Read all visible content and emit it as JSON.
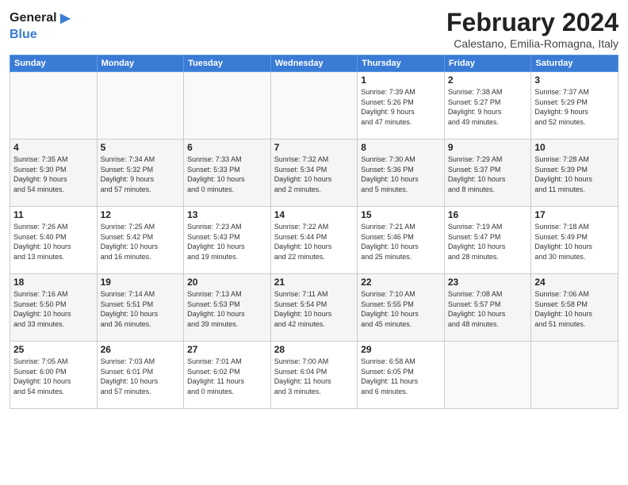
{
  "header": {
    "logo_line1": "General",
    "logo_line2": "Blue",
    "title": "February 2024",
    "subtitle": "Calestano, Emilia-Romagna, Italy"
  },
  "weekdays": [
    "Sunday",
    "Monday",
    "Tuesday",
    "Wednesday",
    "Thursday",
    "Friday",
    "Saturday"
  ],
  "weeks": [
    [
      {
        "day": "",
        "info": ""
      },
      {
        "day": "",
        "info": ""
      },
      {
        "day": "",
        "info": ""
      },
      {
        "day": "",
        "info": ""
      },
      {
        "day": "1",
        "info": "Sunrise: 7:39 AM\nSunset: 5:26 PM\nDaylight: 9 hours\nand 47 minutes."
      },
      {
        "day": "2",
        "info": "Sunrise: 7:38 AM\nSunset: 5:27 PM\nDaylight: 9 hours\nand 49 minutes."
      },
      {
        "day": "3",
        "info": "Sunrise: 7:37 AM\nSunset: 5:29 PM\nDaylight: 9 hours\nand 52 minutes."
      }
    ],
    [
      {
        "day": "4",
        "info": "Sunrise: 7:35 AM\nSunset: 5:30 PM\nDaylight: 9 hours\nand 54 minutes."
      },
      {
        "day": "5",
        "info": "Sunrise: 7:34 AM\nSunset: 5:32 PM\nDaylight: 9 hours\nand 57 minutes."
      },
      {
        "day": "6",
        "info": "Sunrise: 7:33 AM\nSunset: 5:33 PM\nDaylight: 10 hours\nand 0 minutes."
      },
      {
        "day": "7",
        "info": "Sunrise: 7:32 AM\nSunset: 5:34 PM\nDaylight: 10 hours\nand 2 minutes."
      },
      {
        "day": "8",
        "info": "Sunrise: 7:30 AM\nSunset: 5:36 PM\nDaylight: 10 hours\nand 5 minutes."
      },
      {
        "day": "9",
        "info": "Sunrise: 7:29 AM\nSunset: 5:37 PM\nDaylight: 10 hours\nand 8 minutes."
      },
      {
        "day": "10",
        "info": "Sunrise: 7:28 AM\nSunset: 5:39 PM\nDaylight: 10 hours\nand 11 minutes."
      }
    ],
    [
      {
        "day": "11",
        "info": "Sunrise: 7:26 AM\nSunset: 5:40 PM\nDaylight: 10 hours\nand 13 minutes."
      },
      {
        "day": "12",
        "info": "Sunrise: 7:25 AM\nSunset: 5:42 PM\nDaylight: 10 hours\nand 16 minutes."
      },
      {
        "day": "13",
        "info": "Sunrise: 7:23 AM\nSunset: 5:43 PM\nDaylight: 10 hours\nand 19 minutes."
      },
      {
        "day": "14",
        "info": "Sunrise: 7:22 AM\nSunset: 5:44 PM\nDaylight: 10 hours\nand 22 minutes."
      },
      {
        "day": "15",
        "info": "Sunrise: 7:21 AM\nSunset: 5:46 PM\nDaylight: 10 hours\nand 25 minutes."
      },
      {
        "day": "16",
        "info": "Sunrise: 7:19 AM\nSunset: 5:47 PM\nDaylight: 10 hours\nand 28 minutes."
      },
      {
        "day": "17",
        "info": "Sunrise: 7:18 AM\nSunset: 5:49 PM\nDaylight: 10 hours\nand 30 minutes."
      }
    ],
    [
      {
        "day": "18",
        "info": "Sunrise: 7:16 AM\nSunset: 5:50 PM\nDaylight: 10 hours\nand 33 minutes."
      },
      {
        "day": "19",
        "info": "Sunrise: 7:14 AM\nSunset: 5:51 PM\nDaylight: 10 hours\nand 36 minutes."
      },
      {
        "day": "20",
        "info": "Sunrise: 7:13 AM\nSunset: 5:53 PM\nDaylight: 10 hours\nand 39 minutes."
      },
      {
        "day": "21",
        "info": "Sunrise: 7:11 AM\nSunset: 5:54 PM\nDaylight: 10 hours\nand 42 minutes."
      },
      {
        "day": "22",
        "info": "Sunrise: 7:10 AM\nSunset: 5:55 PM\nDaylight: 10 hours\nand 45 minutes."
      },
      {
        "day": "23",
        "info": "Sunrise: 7:08 AM\nSunset: 5:57 PM\nDaylight: 10 hours\nand 48 minutes."
      },
      {
        "day": "24",
        "info": "Sunrise: 7:06 AM\nSunset: 5:58 PM\nDaylight: 10 hours\nand 51 minutes."
      }
    ],
    [
      {
        "day": "25",
        "info": "Sunrise: 7:05 AM\nSunset: 6:00 PM\nDaylight: 10 hours\nand 54 minutes."
      },
      {
        "day": "26",
        "info": "Sunrise: 7:03 AM\nSunset: 6:01 PM\nDaylight: 10 hours\nand 57 minutes."
      },
      {
        "day": "27",
        "info": "Sunrise: 7:01 AM\nSunset: 6:02 PM\nDaylight: 11 hours\nand 0 minutes."
      },
      {
        "day": "28",
        "info": "Sunrise: 7:00 AM\nSunset: 6:04 PM\nDaylight: 11 hours\nand 3 minutes."
      },
      {
        "day": "29",
        "info": "Sunrise: 6:58 AM\nSunset: 6:05 PM\nDaylight: 11 hours\nand 6 minutes."
      },
      {
        "day": "",
        "info": ""
      },
      {
        "day": "",
        "info": ""
      }
    ]
  ]
}
